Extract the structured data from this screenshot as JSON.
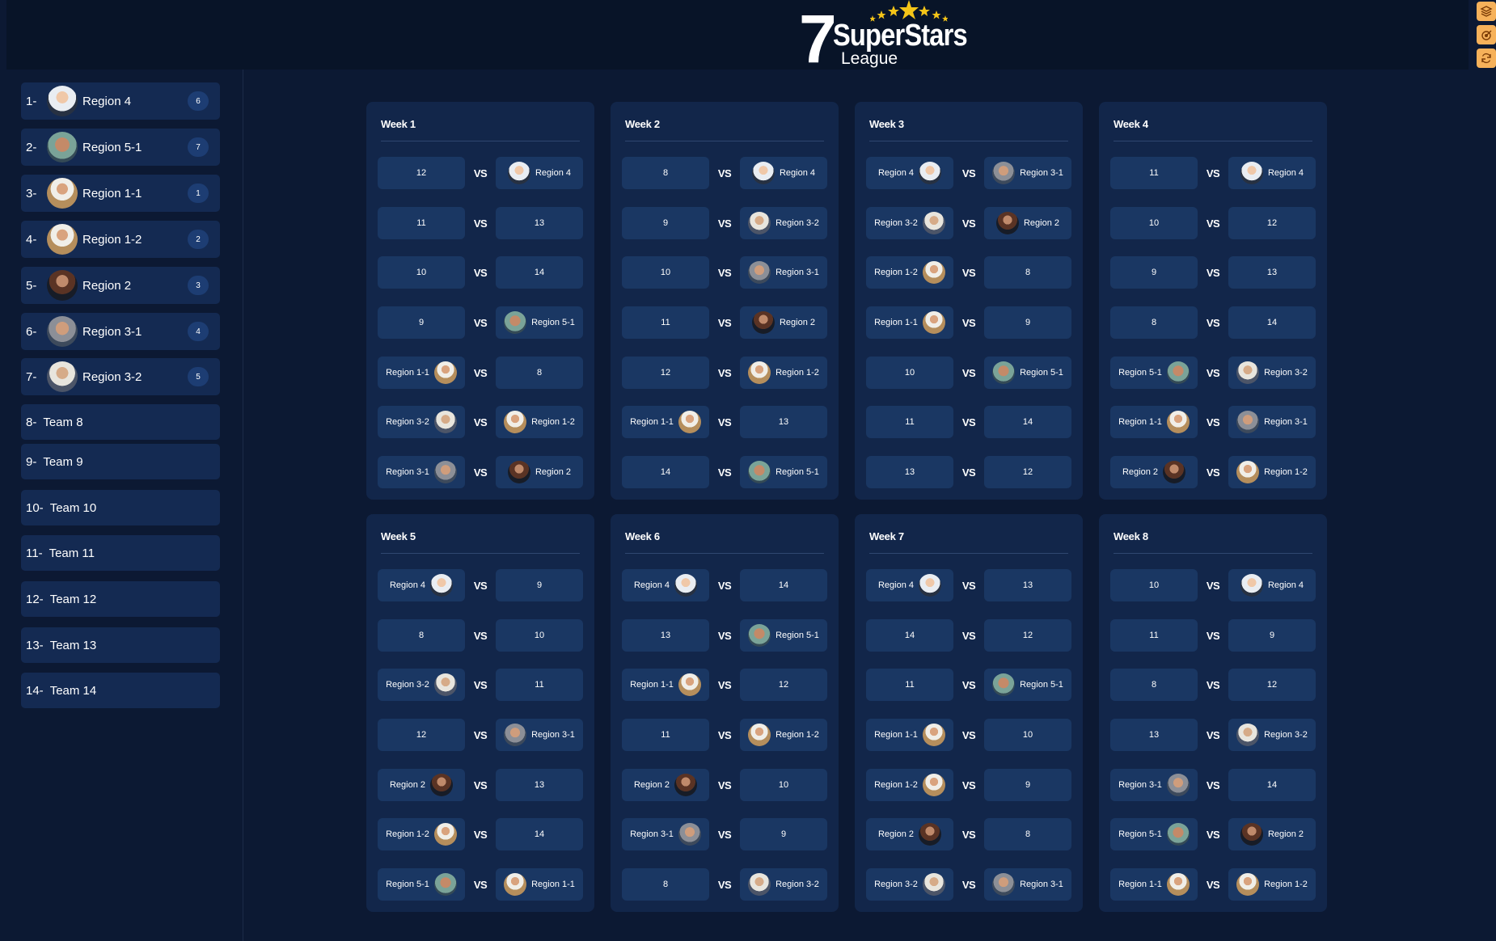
{
  "header": {
    "logo": {
      "number": "7",
      "name": "SuperStars",
      "sub": "League"
    }
  },
  "toolbar": {
    "icons": [
      "layers-icon",
      "target-icon",
      "refresh-icon"
    ]
  },
  "standings": [
    {
      "rank": "1-",
      "name": "Region 4",
      "badge": "6",
      "avatar": true
    },
    {
      "rank": "2-",
      "name": "Region 5-1",
      "badge": "7",
      "avatar": true
    },
    {
      "rank": "3-",
      "name": "Region 1-1",
      "badge": "1",
      "avatar": true
    },
    {
      "rank": "4-",
      "name": "Region 1-2",
      "badge": "2",
      "avatar": true
    },
    {
      "rank": "5-",
      "name": "Region 2",
      "badge": "3",
      "avatar": true
    },
    {
      "rank": "6-",
      "name": "Region 3-1",
      "badge": "4",
      "avatar": true
    },
    {
      "rank": "7-",
      "name": "Region 3-2",
      "badge": "5",
      "avatar": true
    },
    {
      "rank": "8-",
      "name": "Team 8",
      "badge": "",
      "avatar": false
    },
    {
      "rank": "9-",
      "name": "Team 9",
      "badge": "",
      "avatar": false
    },
    {
      "rank": "10-",
      "name": "Team 10",
      "badge": "",
      "avatar": false
    },
    {
      "rank": "11-",
      "name": "Team 11",
      "badge": "",
      "avatar": false
    },
    {
      "rank": "12-",
      "name": "Team 12",
      "badge": "",
      "avatar": false
    },
    {
      "rank": "13-",
      "name": "Team 13",
      "badge": "",
      "avatar": false
    },
    {
      "rank": "14-",
      "name": "Team 14",
      "badge": "",
      "avatar": false
    }
  ],
  "vs_label": "VS",
  "weeks": [
    {
      "title": "Week 1",
      "matches": [
        [
          {
            "label": "12"
          },
          {
            "label": "Region 4",
            "avatar": 0
          }
        ],
        [
          {
            "label": "11"
          },
          {
            "label": "13"
          }
        ],
        [
          {
            "label": "10"
          },
          {
            "label": "14"
          }
        ],
        [
          {
            "label": "9"
          },
          {
            "label": "Region 5-1",
            "avatar": 1
          }
        ],
        [
          {
            "label": "Region 1-1",
            "avatar": 2
          },
          {
            "label": "8"
          }
        ],
        [
          {
            "label": "Region 3-2",
            "avatar": 6
          },
          {
            "label": "Region 1-2",
            "avatar": 3
          }
        ],
        [
          {
            "label": "Region 3-1",
            "avatar": 5
          },
          {
            "label": "Region 2",
            "avatar": 4
          }
        ]
      ]
    },
    {
      "title": "Week 2",
      "matches": [
        [
          {
            "label": "8"
          },
          {
            "label": "Region 4",
            "avatar": 0
          }
        ],
        [
          {
            "label": "9"
          },
          {
            "label": "Region 3-2",
            "avatar": 6
          }
        ],
        [
          {
            "label": "10"
          },
          {
            "label": "Region 3-1",
            "avatar": 5
          }
        ],
        [
          {
            "label": "11"
          },
          {
            "label": "Region 2",
            "avatar": 4
          }
        ],
        [
          {
            "label": "12"
          },
          {
            "label": "Region 1-2",
            "avatar": 3
          }
        ],
        [
          {
            "label": "Region 1-1",
            "avatar": 2
          },
          {
            "label": "13"
          }
        ],
        [
          {
            "label": "14"
          },
          {
            "label": "Region 5-1",
            "avatar": 1
          }
        ]
      ]
    },
    {
      "title": "Week 3",
      "matches": [
        [
          {
            "label": "Region 4",
            "avatar": 0
          },
          {
            "label": "Region 3-1",
            "avatar": 5
          }
        ],
        [
          {
            "label": "Region 3-2",
            "avatar": 6
          },
          {
            "label": "Region 2",
            "avatar": 4
          }
        ],
        [
          {
            "label": "Region 1-2",
            "avatar": 3
          },
          {
            "label": "8"
          }
        ],
        [
          {
            "label": "Region 1-1",
            "avatar": 2
          },
          {
            "label": "9"
          }
        ],
        [
          {
            "label": "10"
          },
          {
            "label": "Region 5-1",
            "avatar": 1
          }
        ],
        [
          {
            "label": "11"
          },
          {
            "label": "14"
          }
        ],
        [
          {
            "label": "13"
          },
          {
            "label": "12"
          }
        ]
      ]
    },
    {
      "title": "Week 4",
      "matches": [
        [
          {
            "label": "11"
          },
          {
            "label": "Region 4",
            "avatar": 0
          }
        ],
        [
          {
            "label": "10"
          },
          {
            "label": "12"
          }
        ],
        [
          {
            "label": "9"
          },
          {
            "label": "13"
          }
        ],
        [
          {
            "label": "8"
          },
          {
            "label": "14"
          }
        ],
        [
          {
            "label": "Region 5-1",
            "avatar": 1
          },
          {
            "label": "Region 3-2",
            "avatar": 6
          }
        ],
        [
          {
            "label": "Region 1-1",
            "avatar": 2
          },
          {
            "label": "Region 3-1",
            "avatar": 5
          }
        ],
        [
          {
            "label": "Region 2",
            "avatar": 4
          },
          {
            "label": "Region 1-2",
            "avatar": 3
          }
        ]
      ]
    },
    {
      "title": "Week 5",
      "matches": [
        [
          {
            "label": "Region 4",
            "avatar": 0
          },
          {
            "label": "9"
          }
        ],
        [
          {
            "label": "8"
          },
          {
            "label": "10"
          }
        ],
        [
          {
            "label": "Region 3-2",
            "avatar": 6
          },
          {
            "label": "11"
          }
        ],
        [
          {
            "label": "12"
          },
          {
            "label": "Region 3-1",
            "avatar": 5
          }
        ],
        [
          {
            "label": "Region 2",
            "avatar": 4
          },
          {
            "label": "13"
          }
        ],
        [
          {
            "label": "Region 1-2",
            "avatar": 3
          },
          {
            "label": "14"
          }
        ],
        [
          {
            "label": "Region 5-1",
            "avatar": 1
          },
          {
            "label": "Region 1-1",
            "avatar": 2
          }
        ]
      ]
    },
    {
      "title": "Week 6",
      "matches": [
        [
          {
            "label": "Region 4",
            "avatar": 0
          },
          {
            "label": "14"
          }
        ],
        [
          {
            "label": "13"
          },
          {
            "label": "Region 5-1",
            "avatar": 1
          }
        ],
        [
          {
            "label": "Region 1-1",
            "avatar": 2
          },
          {
            "label": "12"
          }
        ],
        [
          {
            "label": "11"
          },
          {
            "label": "Region 1-2",
            "avatar": 3
          }
        ],
        [
          {
            "label": "Region 2",
            "avatar": 4
          },
          {
            "label": "10"
          }
        ],
        [
          {
            "label": "Region 3-1",
            "avatar": 5
          },
          {
            "label": "9"
          }
        ],
        [
          {
            "label": "8"
          },
          {
            "label": "Region 3-2",
            "avatar": 6
          }
        ]
      ]
    },
    {
      "title": "Week 7",
      "matches": [
        [
          {
            "label": "Region 4",
            "avatar": 0
          },
          {
            "label": "13"
          }
        ],
        [
          {
            "label": "14"
          },
          {
            "label": "12"
          }
        ],
        [
          {
            "label": "11"
          },
          {
            "label": "Region 5-1",
            "avatar": 1
          }
        ],
        [
          {
            "label": "Region 1-1",
            "avatar": 2
          },
          {
            "label": "10"
          }
        ],
        [
          {
            "label": "Region 1-2",
            "avatar": 3
          },
          {
            "label": "9"
          }
        ],
        [
          {
            "label": "Region 2",
            "avatar": 4
          },
          {
            "label": "8"
          }
        ],
        [
          {
            "label": "Region 3-2",
            "avatar": 6
          },
          {
            "label": "Region 3-1",
            "avatar": 5
          }
        ]
      ]
    },
    {
      "title": "Week 8",
      "matches": [
        [
          {
            "label": "10"
          },
          {
            "label": "Region 4",
            "avatar": 0
          }
        ],
        [
          {
            "label": "11"
          },
          {
            "label": "9"
          }
        ],
        [
          {
            "label": "8"
          },
          {
            "label": "12"
          }
        ],
        [
          {
            "label": "13"
          },
          {
            "label": "Region 3-2",
            "avatar": 6
          }
        ],
        [
          {
            "label": "Region 3-1",
            "avatar": 5
          },
          {
            "label": "14"
          }
        ],
        [
          {
            "label": "Region 5-1",
            "avatar": 1
          },
          {
            "label": "Region 2",
            "avatar": 4
          }
        ],
        [
          {
            "label": "Region 1-1",
            "avatar": 2
          },
          {
            "label": "Region 1-2",
            "avatar": 3
          }
        ]
      ]
    }
  ]
}
